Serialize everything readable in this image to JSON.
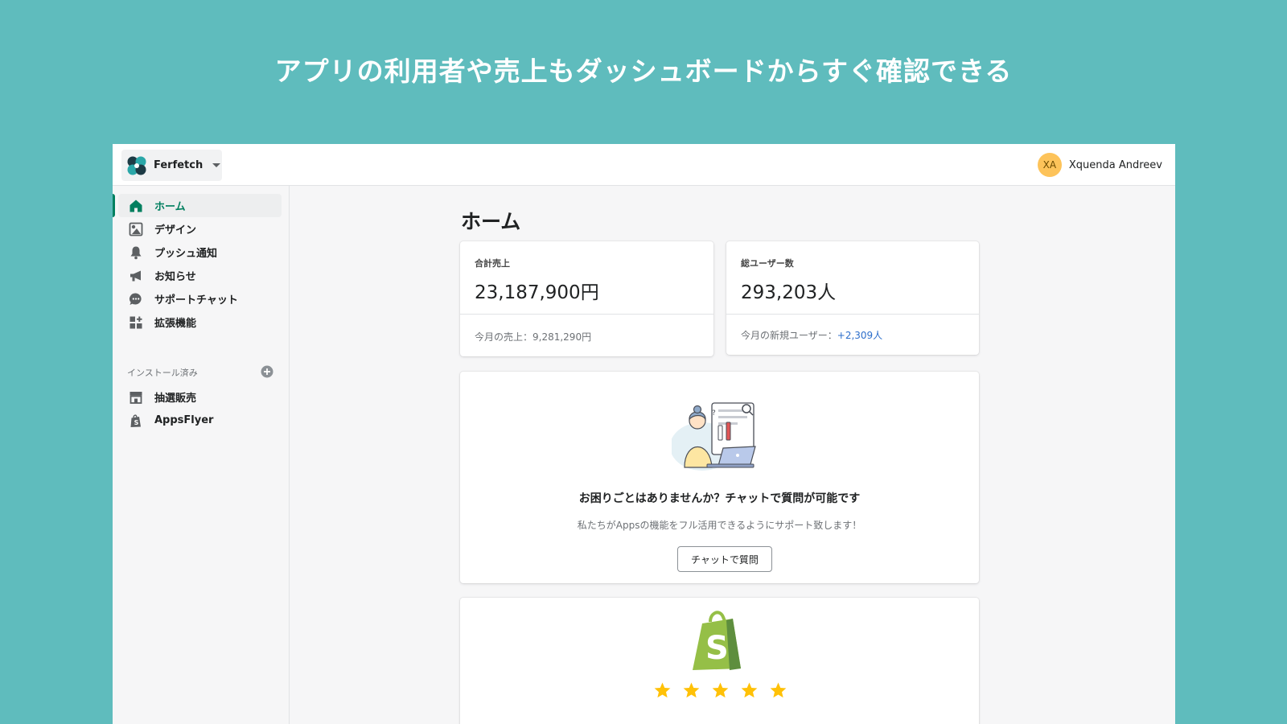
{
  "banner": {
    "headline": "アプリの利用者や売上もダッシュボードからすぐ確認できる"
  },
  "topbar": {
    "store_name": "Ferfetch",
    "user_initials": "XA",
    "user_name": "Xquenda Andreev"
  },
  "sidebar": {
    "items": [
      {
        "label": "ホーム",
        "icon": "home-icon",
        "active": true
      },
      {
        "label": "デザイン",
        "icon": "design-icon"
      },
      {
        "label": "プッシュ通知",
        "icon": "bell-icon"
      },
      {
        "label": "お知らせ",
        "icon": "megaphone-icon"
      },
      {
        "label": "サポートチャット",
        "icon": "chat-icon"
      },
      {
        "label": "拡張機能",
        "icon": "apps-icon"
      }
    ],
    "installed_title": "インストール済み",
    "installed": [
      {
        "label": "抽選販売",
        "icon": "store-icon"
      },
      {
        "label": "AppsFlyer",
        "icon": "shopify-bag-icon"
      }
    ]
  },
  "main": {
    "page_title": "ホーム",
    "sales_card": {
      "label": "合計売上",
      "value": "23,187,900円",
      "footer": "今月の売上：9,281,290円"
    },
    "users_card": {
      "label": "総ユーザー数",
      "value": "293,203人",
      "footer_prefix": "今月の新規ユーザー：",
      "footer_accent": "+2,309人"
    },
    "help_card": {
      "title": "お困りごとはありませんか？チャットで質問が可能です",
      "description": "私たちがAppsの機能をフル活用できるようにサポート致します！",
      "button_label": "チャットで質問"
    },
    "review_card": {
      "rating": 5,
      "max_rating": 5
    }
  },
  "colors": {
    "background": "#5fbcbd",
    "accent_green": "#008060",
    "link_blue": "#2c6ecb",
    "avatar": "#fdc35a",
    "shopify_green": "#95bf47",
    "star": "#ffc107"
  }
}
